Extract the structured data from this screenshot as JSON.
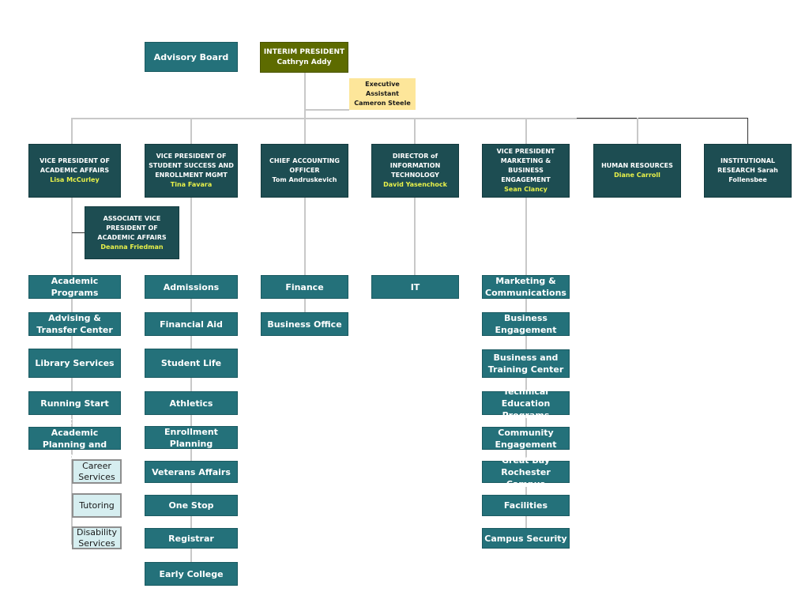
{
  "president": {
    "title": "INTERIM PRESIDENT",
    "name": "Cathryn Addy"
  },
  "advisory": {
    "label": "Advisory Board"
  },
  "assistant": {
    "line1": "Executive",
    "line2": "Assistant",
    "name": "Cameron Steele"
  },
  "executives": [
    {
      "title": "VICE PRESIDENT OF ACADEMIC AFFAIRS",
      "name": "Lisa McCurley"
    },
    {
      "title": "VICE PRESIDENT OF STUDENT SUCCESS AND ENROLLMENT MGMT",
      "name": "Tina Favara"
    },
    {
      "title": "CHIEF ACCOUNTING OFFICER",
      "name": "Tom Andruskevich"
    },
    {
      "title": "DIRECTOR of INFORMATION TECHNOLOGY",
      "name": "David Yasenchock"
    },
    {
      "title": "VICE PRESIDENT MARKETING & BUSINESS ENGAGEMENT",
      "name": "Sean Clancy"
    },
    {
      "title": "HUMAN RESOURCES",
      "name": "Diane Carroll"
    },
    {
      "title": "INSTITUTIONAL RESEARCH Sarah Follensbee"
    }
  ],
  "associate_vp": {
    "title": "ASSOCIATE VICE PRESIDENT OF ACADEMIC AFFAIRS",
    "name": "Deanna Friedman"
  },
  "academic_units": [
    "Academic Programs",
    "Advising & Transfer Center",
    "Library Services",
    "Running Start",
    "Center for Academic Planning and Support"
  ],
  "academic_subunits": [
    "Career Services",
    "Tutoring",
    "Disability Services"
  ],
  "student_units": [
    "Admissions",
    "Financial Aid",
    "Student Life",
    "Athletics",
    "Enrollment Planning",
    "Veterans Affairs",
    "One Stop",
    "Registrar",
    "Early College"
  ],
  "finance_units": [
    "Finance",
    "Business Office"
  ],
  "it_units": [
    "IT"
  ],
  "marketing_units": [
    "Marketing & Communications",
    "Business Engagement",
    "Business and Training Center",
    "Technical Education Programs",
    "Community Engagement",
    "Great Bay Rochester Campus",
    "Facilities",
    "Campus Security"
  ]
}
